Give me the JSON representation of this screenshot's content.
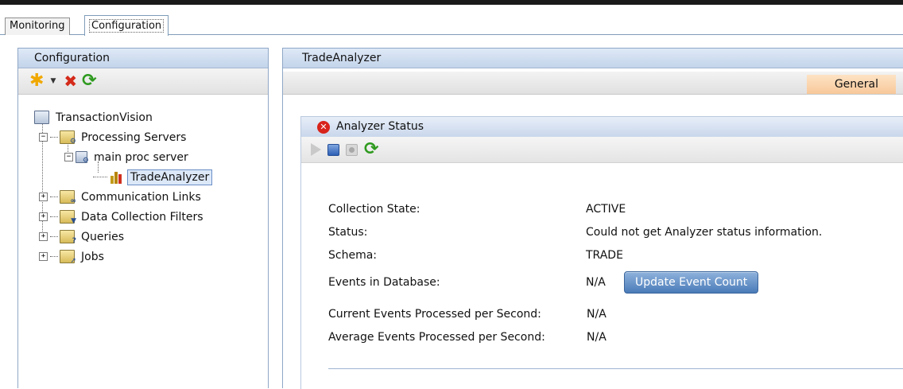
{
  "tabs": [
    {
      "label": "Monitoring",
      "active": false
    },
    {
      "label": "Configuration",
      "active": true
    }
  ],
  "left_panel": {
    "title": "Configuration",
    "toolbar": [
      {
        "name": "new",
        "icon": "asterisk-icon",
        "color": "#f0a800"
      },
      {
        "name": "dropdown",
        "icon": "dropdown-arrow-icon"
      },
      {
        "name": "delete",
        "icon": "red-x-icon",
        "color": "#d42a1a"
      },
      {
        "name": "refresh",
        "icon": "refresh-icon",
        "color": "#2e9a1f"
      }
    ],
    "tree": {
      "root": "TransactionVision",
      "processing_servers": "Processing Servers",
      "main_proc_server": "main proc server",
      "trade_analyzer": "TradeAnalyzer",
      "communication_links": "Communication Links",
      "data_collection_filters": "Data Collection Filters",
      "queries": "Queries",
      "jobs": "Jobs"
    },
    "expander_open": "−",
    "expander_closed": "+"
  },
  "right_panel": {
    "title": "TradeAnalyzer",
    "subtab": "General",
    "status_panel": {
      "title": "Analyzer Status",
      "status_icon": "error-icon",
      "rows": {
        "collection_state_label": "Collection State:",
        "collection_state_value": "ACTIVE",
        "status_label": "Status:",
        "status_value": "Could not get Analyzer status information.",
        "schema_label": "Schema:",
        "schema_value": "TRADE",
        "events_label": "Events in Database:",
        "events_value": "N/A",
        "update_button": "Update Event Count",
        "current_label": "Current Events Processed per Second:",
        "current_value": "N/A",
        "average_label": "Average Events Processed per Second:",
        "average_value": "N/A"
      }
    }
  },
  "colors": {
    "header_blue": "#c3d4ea",
    "subtab_orange": "#f8c89a",
    "button_blue": "#4a7bb8",
    "error_red": "#d8241b"
  }
}
